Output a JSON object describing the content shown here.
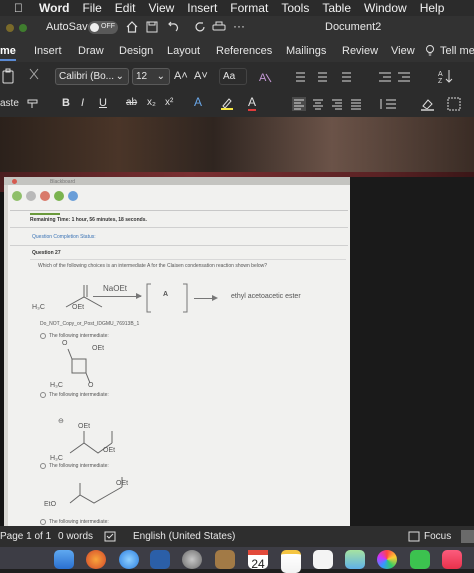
{
  "menubar": {
    "app": "Word",
    "items": [
      "File",
      "Edit",
      "View",
      "Insert",
      "Format",
      "Tools",
      "Table",
      "Window",
      "Help"
    ]
  },
  "titlebar": {
    "autosave_label": "AutoSave",
    "autosave_state": "OFF",
    "document_title": "Document2",
    "more": "···"
  },
  "ribbon_tabs": [
    "me",
    "Insert",
    "Draw",
    "Design",
    "Layout",
    "References",
    "Mailings",
    "Review",
    "View",
    "Tell me"
  ],
  "ribbon": {
    "paste_label": "aste",
    "font_name": "Calibri (Bo...",
    "font_size": "12",
    "grow_font": "A˄",
    "shrink_font": "A˅",
    "change_case": "Aa",
    "bold": "B",
    "italic": "I",
    "underline": "U",
    "strike": "ab",
    "subscript": "x₂",
    "superscript": "x²",
    "text_effects": "A",
    "font_color": "A"
  },
  "photo": {
    "blackboard_title": "Blackboard",
    "remaining_time": "Remaining Time: 1 hour, 56 minutes, 18 seconds.",
    "completion_status": "Question Completion Status:",
    "question_label": "Question 27",
    "question_text": "Which of the following choices is an intermediate A for the Claisen condensation reaction shown below?",
    "reagent": "NaOEt",
    "intermediate_box": "A",
    "product": "ethyl acetoacetic ester",
    "ester_left": "H₃C",
    "ester_right": "OEt",
    "watermark": "Do_NOT_Copy_or_Post_IDGMU_76913B_1",
    "options": [
      "The following intermediate:",
      "The following intermediate:",
      "The following intermediate:",
      "The following intermediate:"
    ],
    "chem_oet": "OEt",
    "chem_h3c": "H₃C",
    "chem_o": "O",
    "chem_eto": "EtO"
  },
  "status": {
    "page": "Page 1 of 1",
    "words": "0 words",
    "language": "English (United States)",
    "focus": "Focus"
  },
  "dock": {
    "calendar_day": "24"
  }
}
